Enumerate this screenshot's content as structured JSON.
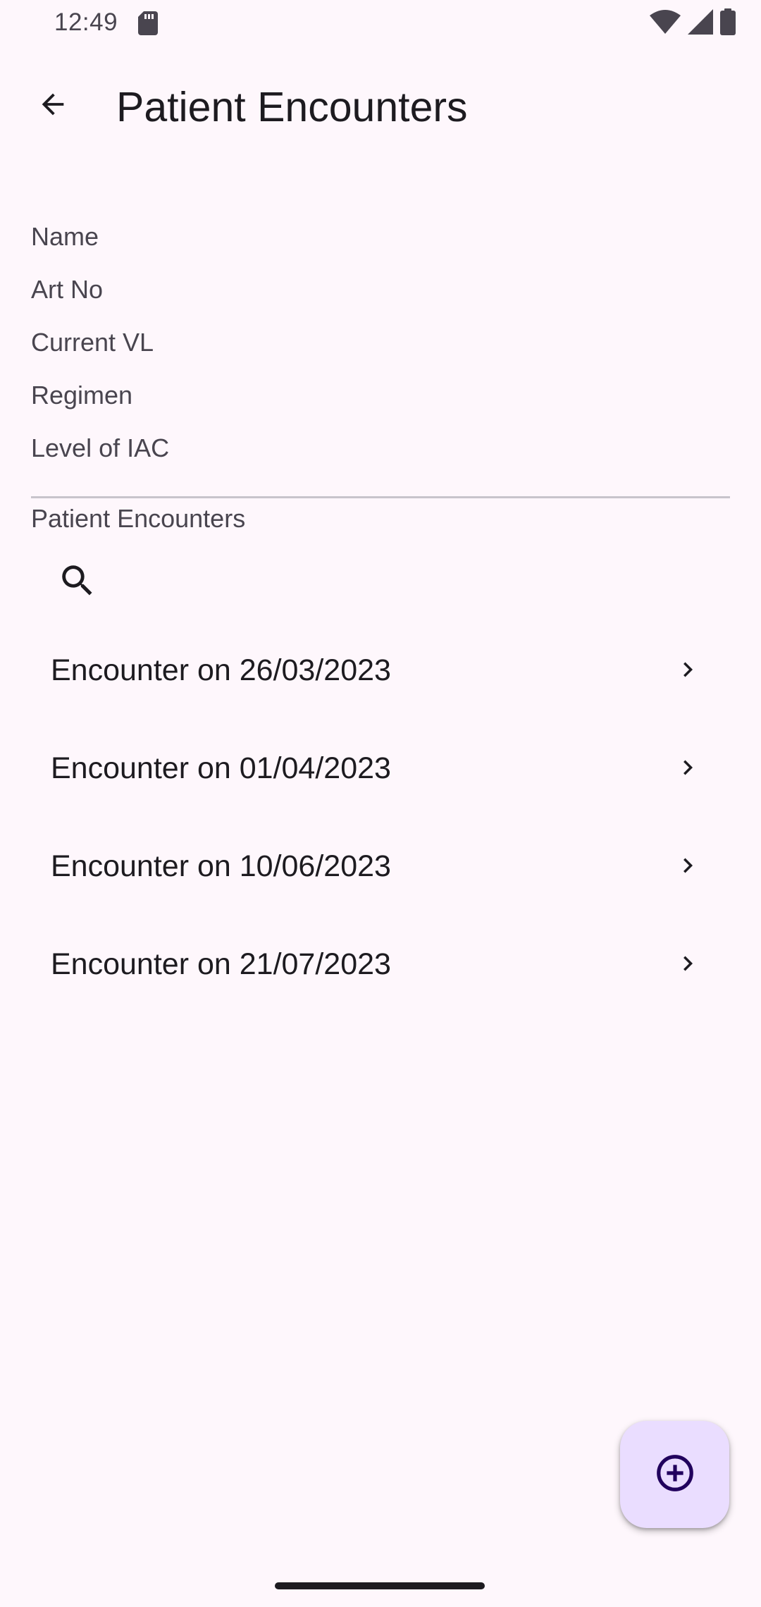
{
  "status_bar": {
    "time": "12:49",
    "icons": [
      "sd-card-icon",
      "wifi-icon",
      "signal-icon",
      "battery-icon"
    ]
  },
  "app_bar": {
    "title": "Patient Encounters",
    "back_icon": "arrow-back-icon"
  },
  "patient_info": {
    "fields": [
      "Name",
      "Art No",
      "Current VL",
      "Regimen",
      "Level of IAC"
    ]
  },
  "encounters_section": {
    "label": "Patient Encounters",
    "search_icon": "search-icon",
    "items": [
      {
        "label": "Encounter on 26/03/2023"
      },
      {
        "label": "Encounter on 01/04/2023"
      },
      {
        "label": "Encounter on 10/06/2023"
      },
      {
        "label": "Encounter on 21/07/2023"
      }
    ]
  },
  "fab": {
    "icon": "add-circle-icon"
  },
  "colors": {
    "background": "#fef7fc",
    "fab_background": "#eaddff",
    "fab_icon": "#21005d",
    "text_primary": "#1d1b20",
    "text_secondary": "#49454f"
  }
}
